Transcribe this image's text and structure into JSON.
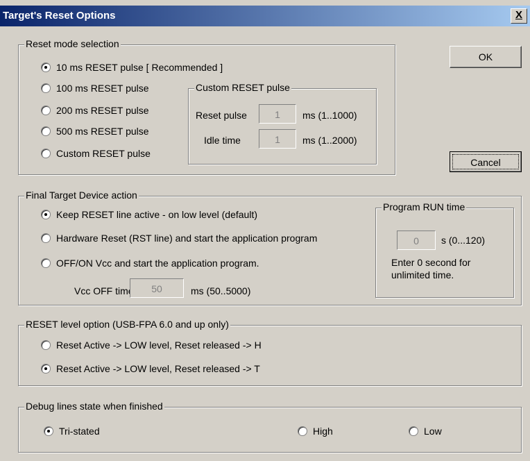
{
  "window": {
    "title": "Target's Reset Options",
    "close_label": "X"
  },
  "buttons": {
    "ok": "OK",
    "cancel": "Cancel"
  },
  "reset_mode": {
    "legend": "Reset mode selection",
    "options": [
      {
        "label": "10 ms RESET pulse  [ Recommended ]",
        "selected": true
      },
      {
        "label": "100 ms RESET pulse",
        "selected": false
      },
      {
        "label": "200 ms RESET pulse",
        "selected": false
      },
      {
        "label": "500 ms RESET pulse",
        "selected": false
      },
      {
        "label": "Custom RESET pulse",
        "selected": false
      }
    ],
    "custom": {
      "legend": "Custom RESET pulse",
      "reset_pulse_label": "Reset pulse",
      "reset_pulse_value": "1",
      "reset_pulse_unit": "ms (1..1000)",
      "idle_time_label": "Idle time",
      "idle_time_value": "1",
      "idle_time_unit": "ms (1..2000)"
    }
  },
  "final_action": {
    "legend": "Final Target Device action",
    "options": [
      {
        "label": "Keep RESET line active - on low level   (default)",
        "selected": true
      },
      {
        "label": "Hardware Reset (RST line) and start the application program",
        "selected": false
      },
      {
        "label": "OFF/ON Vcc and start the application program.",
        "selected": false
      }
    ],
    "vcc_off_label": "Vcc OFF time:",
    "vcc_off_value": "50",
    "vcc_off_unit": "ms (50..5000)",
    "run_time": {
      "legend": "Program RUN time",
      "value": "0",
      "unit": "s (0...120)",
      "note_line1": "Enter 0 second for",
      "note_line2": "unlimited time."
    }
  },
  "reset_level": {
    "legend": "RESET level option (USB-FPA 6.0 and up only)",
    "options": [
      {
        "label": "Reset Active -> LOW level,  Reset released -> H",
        "selected": false
      },
      {
        "label": "Reset Active -> LOW level,  Reset released -> T",
        "selected": true
      }
    ]
  },
  "debug_lines": {
    "legend": "Debug lines state when finished",
    "options": [
      {
        "label": "Tri-stated",
        "selected": true
      },
      {
        "label": "High",
        "selected": false
      },
      {
        "label": "Low",
        "selected": false
      }
    ]
  }
}
